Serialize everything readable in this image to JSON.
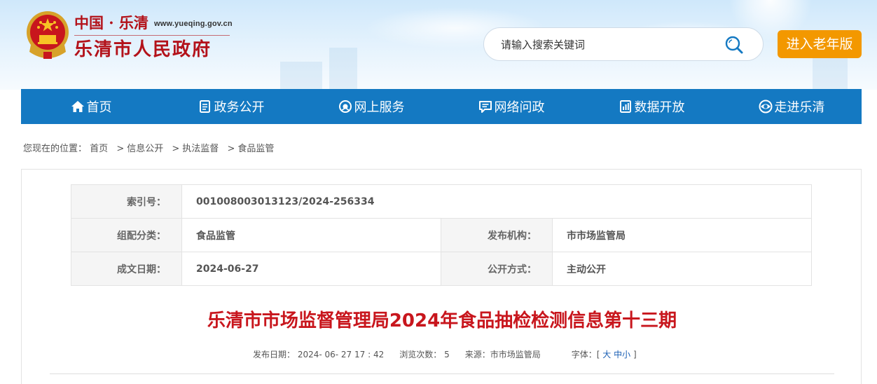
{
  "header": {
    "domain_cn": "中国 · 乐清",
    "url": "www.yueqing.gov.cn",
    "title": "乐清市人民政府",
    "search_placeholder": "请输入搜索关键词",
    "elder_button": "进入老年版"
  },
  "nav": {
    "items": [
      {
        "label": "首页",
        "icon": "home-icon"
      },
      {
        "label": "政务公开",
        "icon": "document-icon"
      },
      {
        "label": "网上服务",
        "icon": "service-icon"
      },
      {
        "label": "网络问政",
        "icon": "chat-icon"
      },
      {
        "label": "数据开放",
        "icon": "data-icon"
      },
      {
        "label": "走进乐清",
        "icon": "eye-icon"
      }
    ]
  },
  "breadcrumb": {
    "prefix": "您现在的位置：",
    "items": [
      "首页",
      "信息公开",
      "执法监督",
      "食品监管"
    ],
    "separator": ">"
  },
  "meta": {
    "index_label": "索引号：",
    "index_value": "001008003013123/2024-256334",
    "category_label": "组配分类：",
    "category_value": "食品监管",
    "publisher_label": "发布机构：",
    "publisher_value": "市市场监管局",
    "date_label": "成文日期：",
    "date_value": "2024-06-27",
    "method_label": "公开方式：",
    "method_value": "主动公开"
  },
  "article": {
    "title": "乐清市市场监督管理局2024年食品抽检检测信息第十三期",
    "publish_date": "发布日期： 2024- 06- 27 17 : 42",
    "views_label": "浏览次数：",
    "views": "5",
    "source": "来源：市市场监管局",
    "font_label": "字体：[",
    "font_large": "大",
    "font_medium": "中",
    "font_small": "小",
    "font_close": "]"
  },
  "colors": {
    "nav_blue": "#1479c2",
    "title_red": "#c8161d",
    "elder_orange": "#f39800"
  }
}
